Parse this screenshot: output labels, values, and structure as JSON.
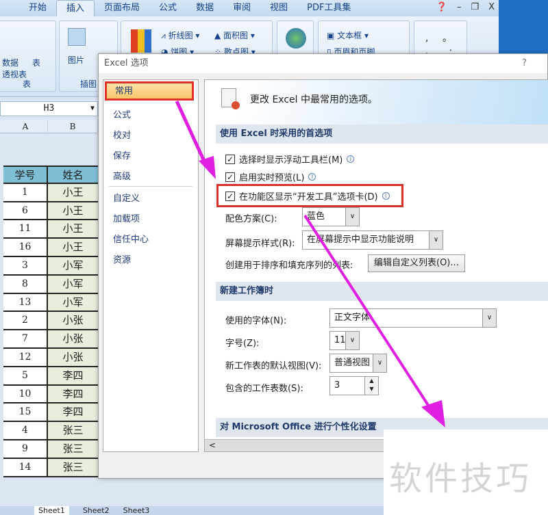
{
  "ribbon": {
    "tabs": [
      "开始",
      "插入",
      "页面布局",
      "公式",
      "数据",
      "审阅",
      "视图",
      "PDF工具集"
    ],
    "active_tab": "插入",
    "buttons": {
      "pivot": "数据\n透视表",
      "table": "表",
      "picture": "图片",
      "line": "折线图",
      "area": "面积图",
      "pie": "饼图",
      "scatter": "散点图",
      "textbox": "文本框",
      "header_footer": "页眉和页脚"
    },
    "groups": {
      "tables": "表",
      "illustrations": "插图"
    },
    "symbols": ", 。 、 ; : ?"
  },
  "sheet": {
    "name_box": "H3",
    "columns": [
      "A",
      "B"
    ],
    "headers": [
      "学号",
      "姓名"
    ],
    "rows": [
      [
        "1",
        "小王"
      ],
      [
        "6",
        "小王"
      ],
      [
        "11",
        "小王"
      ],
      [
        "16",
        "小王"
      ],
      [
        "3",
        "小军"
      ],
      [
        "8",
        "小军"
      ],
      [
        "13",
        "小军"
      ],
      [
        "2",
        "小张"
      ],
      [
        "7",
        "小张"
      ],
      [
        "12",
        "小张"
      ],
      [
        "5",
        "李四"
      ],
      [
        "10",
        "李四"
      ],
      [
        "15",
        "李四"
      ],
      [
        "4",
        "张三"
      ],
      [
        "9",
        "张三"
      ],
      [
        "14",
        "张三"
      ]
    ],
    "sheet_tabs": [
      "Sheet1",
      "Sheet2",
      "Sheet3"
    ]
  },
  "dialog": {
    "title": "Excel 选项",
    "help": "?",
    "nav": [
      "常用",
      "公式",
      "校对",
      "保存",
      "高级",
      "自定义",
      "加载项",
      "信任中心",
      "资源"
    ],
    "banner": "更改 Excel 中最常用的选项。",
    "section1": "使用 Excel 时采用的首选项",
    "opt1": "选择时显示浮动工具栏(M)",
    "opt2": "启用实时预览(L)",
    "opt3": "在功能区显示“开发工具”选项卡(D)",
    "color_label": "配色方案(C):",
    "color_value": "蓝色",
    "tip_label": "屏幕提示样式(R):",
    "tip_value": "在屏幕提示中显示功能说明",
    "list_label": "创建用于排序和填充序列的列表:",
    "list_button": "编辑自定义列表(O)...",
    "section2": "新建工作簿时",
    "font_label": "使用的字体(N):",
    "font_value": "正文字体",
    "size_label": "字号(Z):",
    "size_value": "11",
    "view_label": "新工作表的默认视图(V):",
    "view_value": "普通视图",
    "sheets_label": "包含的工作表数(S):",
    "sheets_value": "3",
    "section3": "对 Microsoft Office 进行个性化设置"
  },
  "watermark": "软件技巧",
  "colors": {
    "highlight": "#d8302a",
    "arrow": "#e020e0"
  }
}
